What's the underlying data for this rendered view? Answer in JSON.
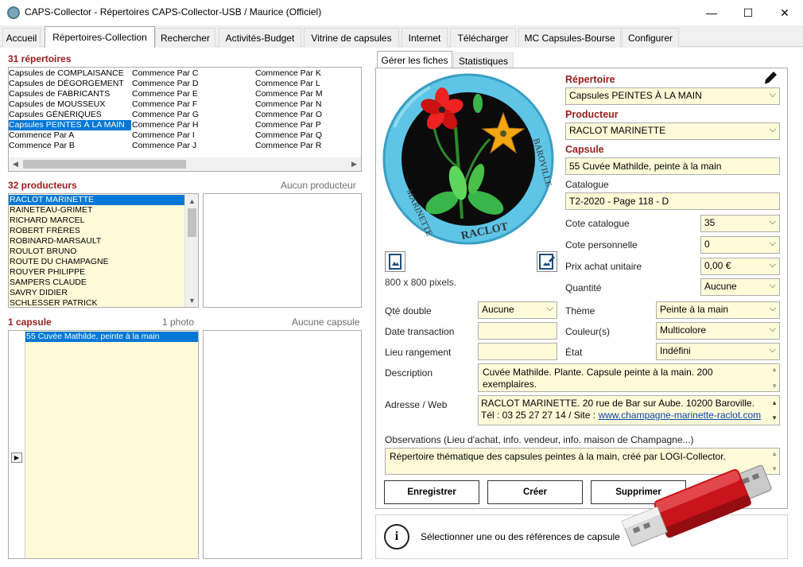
{
  "window": {
    "title": "CAPS-Collector - Répertoires CAPS-Collector-USB / Maurice (Officiel)",
    "minimize": "—",
    "maximize": "☐",
    "close": "✕"
  },
  "tabs": [
    "Accueil",
    "Répertoires-Collection",
    "Rechercher",
    "Activités-Budget",
    "Vitrine de capsules",
    "Internet",
    "Télécharger",
    "MC Capsules-Bourse",
    "Configurer"
  ],
  "active_tab": "Répertoires-Collection",
  "repertoires": {
    "title": "31 répertoires",
    "col1": [
      "Capsules de COMPLAISANCE",
      "Capsules de DÉGORGEMENT",
      "Capsules de FABRICANTS",
      "Capsules de MOUSSEUX",
      "Capsules GÉNÉRIQUES",
      "Capsules PEINTES À LA MAIN",
      "Commence Par A",
      "Commence Par B"
    ],
    "col2": [
      "Commence Par C",
      "Commence Par D",
      "Commence Par E",
      "Commence Par F",
      "Commence Par G",
      "Commence Par H",
      "Commence Par I",
      "Commence Par J"
    ],
    "col3": [
      "Commence Par K",
      "Commence Par L",
      "Commence Par M",
      "Commence Par N",
      "Commence Par O",
      "Commence Par P",
      "Commence Par Q",
      "Commence Par R"
    ],
    "selected": "Capsules PEINTES À LA MAIN"
  },
  "producteurs": {
    "title": "32 producteurs",
    "right_label": "Aucun producteur",
    "items": [
      "RACLOT MARINETTE",
      "RAINETEAU-GRIMET",
      "RICHARD MARCEL",
      "ROBERT FRÈRES",
      "ROBINARD-MARSAULT",
      "ROULOT BRUNO",
      "ROUTE DU CHAMPAGNE",
      "ROUYER PHILIPPE",
      "SAMPERS CLAUDE",
      "SAVRY DIDIER",
      "SCHLESSER PATRICK"
    ],
    "selected": "RACLOT MARINETTE"
  },
  "capsules": {
    "title": "1 capsule",
    "photo_count": "1 photo",
    "right_label": "Aucune capsule",
    "items": [
      "55 Cuvée Mathilde, peinte à la main"
    ],
    "selected": "55 Cuvée Mathilde, peinte à la main"
  },
  "detail_tabs": [
    "Gérer les fiches",
    "Statistiques"
  ],
  "image": {
    "size_text": "800 x 800 pixels.",
    "cap_text_bottom": "RACLOT",
    "cap_text_left": "MARINETTE",
    "cap_text_right": "BAROVILLE"
  },
  "form": {
    "repertoire_label": "Répertoire",
    "repertoire_value": "Capsules PEINTES À LA MAIN",
    "producteur_label": "Producteur",
    "producteur_value": "RACLOT MARINETTE",
    "capsule_label": "Capsule",
    "capsule_value": "55 Cuvée Mathilde, peinte à la main",
    "catalogue_label": "Catalogue",
    "catalogue_value": "T2-2020 - Page 118 - D",
    "cote_catalogue_label": "Cote catalogue",
    "cote_catalogue_value": "35",
    "cote_perso_label": "Cote personnelle",
    "cote_perso_value": "0",
    "prix_label": "Prix achat unitaire",
    "prix_value": "0,00 €",
    "quantite_label": "Quantité",
    "quantite_value": "Aucune",
    "qte_double_label": "Qté double",
    "qte_double_value": "Aucune",
    "theme_label": "Thème",
    "theme_value": "Peinte à la main",
    "date_label": "Date transaction",
    "date_value": "",
    "couleur_label": "Couleur(s)",
    "couleur_value": "Multicolore",
    "lieu_label": "Lieu rangement",
    "lieu_value": "",
    "etat_label": "État",
    "etat_value": "Indéfini",
    "description_label": "Description",
    "description_value": "Cuvée Mathilde. Plante. Capsule peinte à la main. 200 exemplaires.",
    "adresse_label": "Adresse / Web",
    "adresse_line1": "RACLOT MARINETTE. 20 rue de Bar sur Aube. 10200 Baroville.",
    "adresse_line2_prefix": "Tél : 03 25 27 27 14 / Site : ",
    "adresse_link": "www.champagne-marinette-raclot.com",
    "observations_label": "Observations (Lieu d'achat, info. vendeur, info. maison de Champagne...)",
    "observations_value": "Répertoire thématique des capsules peintes à la main, créé par LOGI-Collector."
  },
  "buttons": {
    "save": "Enregistrer",
    "create": "Créer",
    "delete": "Supprimer"
  },
  "info": {
    "text": "Sélectionner une ou des références de capsule"
  },
  "colors": {
    "section_title": "#9b1b1b",
    "selection": "#0078d7",
    "field_bg": "#fffbd9",
    "cap_blue": "#5ec5e6"
  }
}
